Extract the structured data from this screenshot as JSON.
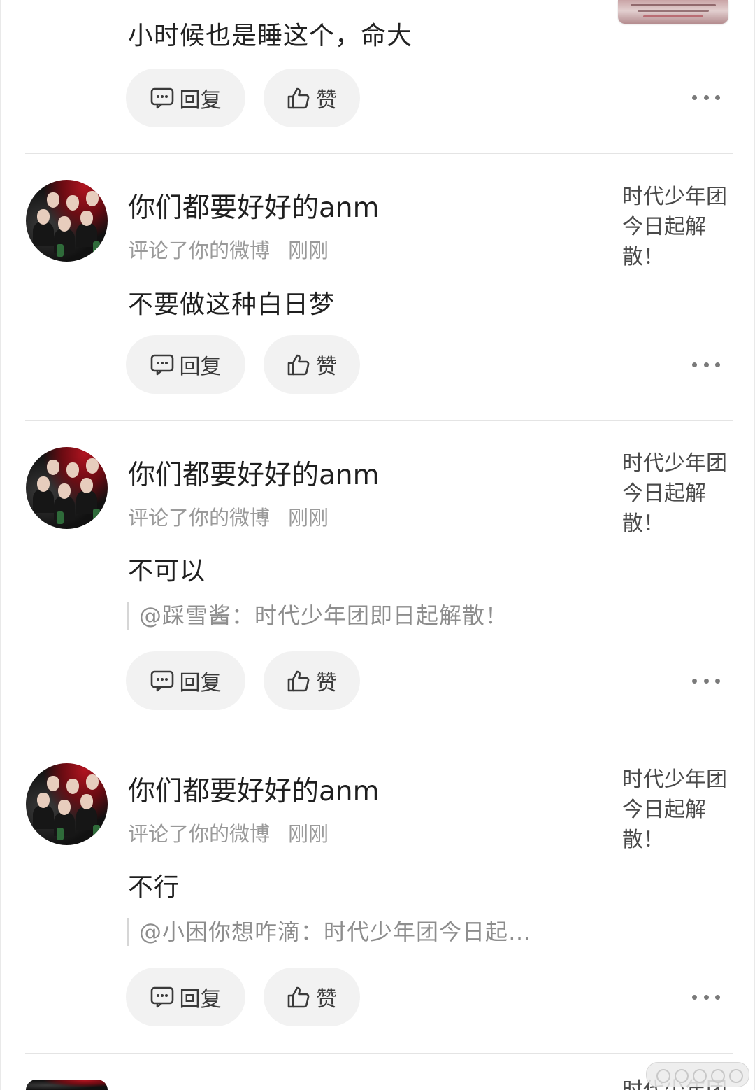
{
  "top": {
    "comment": "小时候也是睡这个，命大",
    "reply_label": "回复",
    "like_label": "赞"
  },
  "notifications": [
    {
      "username": "你们都要好好的anm",
      "action": "评论了你的微博",
      "time": "刚刚",
      "comment": "不要做这种白日梦",
      "quote": "",
      "post_title": "时代少年团今日起解散！",
      "reply_label": "回复",
      "like_label": "赞"
    },
    {
      "username": "你们都要好好的anm",
      "action": "评论了你的微博",
      "time": "刚刚",
      "comment": "不可以",
      "quote": "@踩雪酱：时代少年团即日起解散！",
      "post_title": "时代少年团今日起解散！",
      "reply_label": "回复",
      "like_label": "赞"
    },
    {
      "username": "你们都要好好的anm",
      "action": "评论了你的微博",
      "time": "刚刚",
      "comment": "不行",
      "quote": "@小困你想咋滴：时代少年团今日起…",
      "post_title": "时代少年团今日起解散！",
      "reply_label": "回复",
      "like_label": "赞"
    }
  ],
  "partial_next": {
    "post_title": "时代少年团"
  },
  "icons": {
    "reply": "comment-bubble-icon",
    "like": "thumbs-up-icon",
    "more": "more-dots-icon"
  },
  "colors": {
    "background": "#ffffff",
    "button_bg": "#f2f2f2",
    "meta_text": "#9a9a9a"
  }
}
